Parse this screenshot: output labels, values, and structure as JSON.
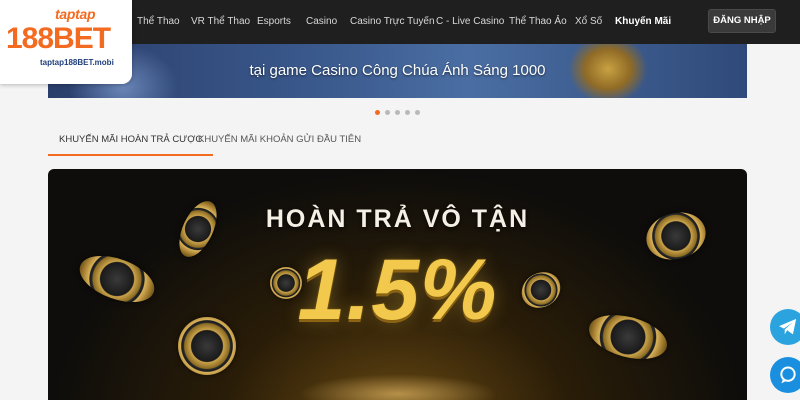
{
  "brand": {
    "taptap": "taptap",
    "logo_main": "188BET",
    "domain": "taptap188BET.mobi"
  },
  "nav": {
    "items": [
      {
        "label": "Thể Thao"
      },
      {
        "label": "VR Thể Thao"
      },
      {
        "label": "Esports"
      },
      {
        "label": "Casino"
      },
      {
        "label": "Casino Trực Tuyến"
      },
      {
        "label": "C - Live Casino"
      },
      {
        "label": "Thể Thao Ảo"
      },
      {
        "label": "Xổ Số"
      },
      {
        "label": "Khuyến Mãi",
        "active": true
      }
    ],
    "login_label": "ĐĂNG NHẬP"
  },
  "hero": {
    "caption": "tại game Casino Công Chúa Ánh Sáng 1000",
    "dots_total": 5,
    "dots_active": 1
  },
  "tabs": [
    {
      "label": "KHUYẾN MÃI HOÀN TRẢ CƯỢC",
      "active": true
    },
    {
      "label": "KHUYẾN MÃI KHOẢN GỬI ĐẦU TIÊN",
      "active": false
    }
  ],
  "promo": {
    "title": "HOÀN TRẢ VÔ TẬN",
    "value": "1.5%"
  },
  "floating": {
    "telegram_icon": "telegram-icon",
    "chat_icon": "chat-icon"
  },
  "colors": {
    "accent": "#f36b21",
    "nav_bg": "#1f1f1f",
    "gold": "#f2c94c"
  }
}
